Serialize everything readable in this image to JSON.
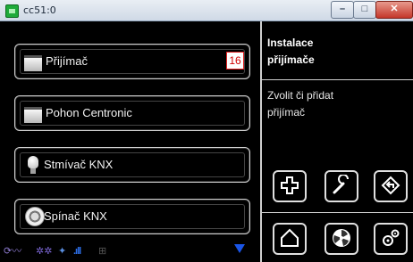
{
  "window": {
    "title": "cc51:0",
    "controls": {
      "minimize": "–",
      "maximize": "□",
      "close": "✕"
    }
  },
  "devices": [
    {
      "label": "Přijímač",
      "icon": "blind-icon",
      "badge": "16"
    },
    {
      "label": "Pohon Centronic",
      "icon": "blind-icon"
    },
    {
      "label": "Stmívač KNX",
      "icon": "bulb-icon"
    },
    {
      "label": "Spínač KNX",
      "icon": "switch-icon"
    }
  ],
  "side": {
    "title_line1": "Instalace",
    "title_line2": "přijímače",
    "desc_line1": "Zvolit či přidat",
    "desc_line2": "přijímač"
  },
  "actions": {
    "add": "add-icon",
    "tool": "wrench-icon",
    "back": "back-icon",
    "home": "home-icon",
    "fan": "fan-icon",
    "settings": "settings-icon"
  },
  "status": {
    "icons": [
      "link-icon",
      "network-icon",
      "antenna-icon",
      "signal-icon",
      "lan-icon"
    ],
    "scroll": "scroll-down-icon"
  },
  "colors": {
    "background": "#000000",
    "accent_blue": "#1a55e6",
    "badge_red": "#d10000",
    "border": "#d0d0d0"
  }
}
